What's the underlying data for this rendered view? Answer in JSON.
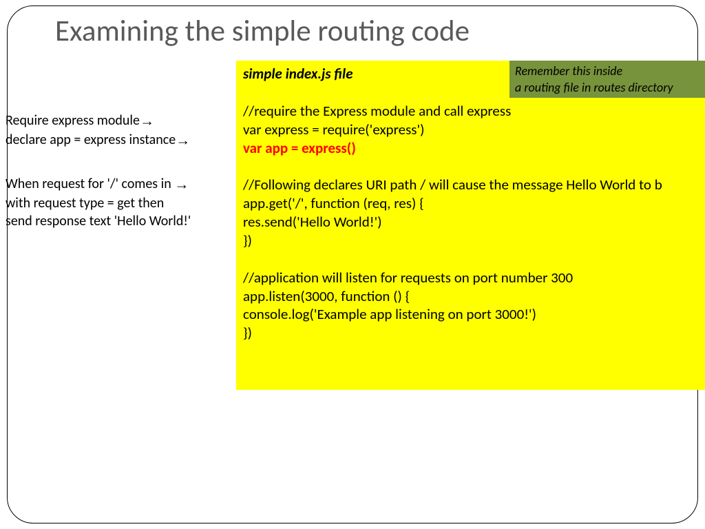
{
  "title": "Examining the simple routing code",
  "left": {
    "line1_pre": "Require express module",
    "line2_pre": "declare app = express instance",
    "line3_pre": "When request for '/' comes in ",
    "line4": "with request type = get then",
    "line5": "send response text  'Hello World!'"
  },
  "arrow_glyph": "→",
  "yellow": {
    "file_title": "simple index.js file",
    "l1": "//require the Express module and call express",
    "l2": "var express = require('express')",
    "l3": "var app = express()",
    "l4": "//Following declares URI path / will cause the message Hello World to b",
    "l5": "app.get('/', function (req, res) {",
    "l6": "res.send('Hello World!')",
    "l7": "})",
    "l8": "//application will listen for requests on port number 300",
    "l9": "app.listen(3000, function () {",
    "l10": "console.log('Example app listening on port 3000!')",
    "l11": "})"
  },
  "green": {
    "line1": "Remember this inside",
    "line2": "a routing file in routes directory"
  }
}
